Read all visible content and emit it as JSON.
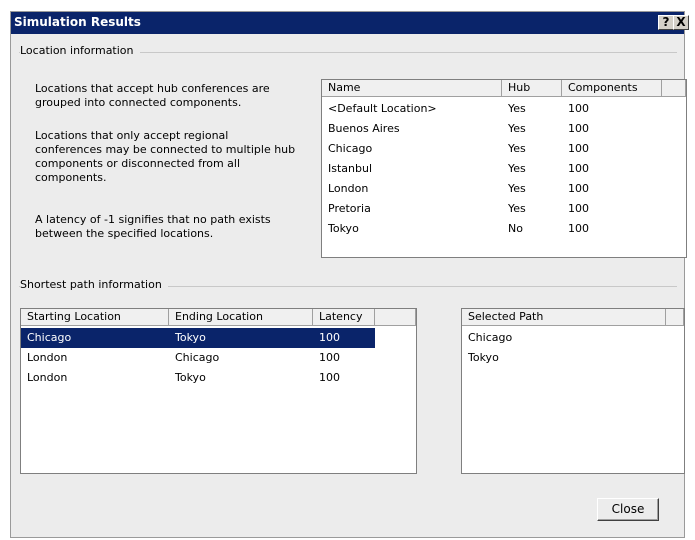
{
  "window": {
    "title": "Simulation Results",
    "help_glyph": "?",
    "close_glyph": "X"
  },
  "location_info": {
    "group_label": "Location information",
    "paragraphs": [
      "Locations that accept hub conferences are grouped into connected components.",
      "Locations that only accept regional conferences may be connected to multiple hub components or disconnected from all components.",
      "A latency of -1 signifies that no path exists between the specified locations."
    ],
    "columns": [
      "Name",
      "Hub",
      "Components"
    ],
    "rows": [
      [
        "<Default Location>",
        "Yes",
        "100"
      ],
      [
        "Buenos Aires",
        "Yes",
        "100"
      ],
      [
        "Chicago",
        "Yes",
        "100"
      ],
      [
        "Istanbul",
        "Yes",
        "100"
      ],
      [
        "London",
        "Yes",
        "100"
      ],
      [
        "Pretoria",
        "Yes",
        "100"
      ],
      [
        "Tokyo",
        "No",
        "100"
      ]
    ]
  },
  "shortest_path": {
    "group_label": "Shortest path information",
    "columns": [
      "Starting Location",
      "Ending Location",
      "Latency"
    ],
    "rows": [
      [
        "Chicago",
        "Tokyo",
        "100"
      ],
      [
        "London",
        "Chicago",
        "100"
      ],
      [
        "London",
        "Tokyo",
        "100"
      ]
    ],
    "selected_row": 0,
    "selected_path_header": "Selected Path",
    "selected_path": [
      "Chicago",
      "Tokyo"
    ]
  },
  "buttons": {
    "close_label": "Close"
  },
  "colors": {
    "title_bar": "#0a246a",
    "selection": "#0a246a",
    "dialog_bg": "#ececec"
  }
}
